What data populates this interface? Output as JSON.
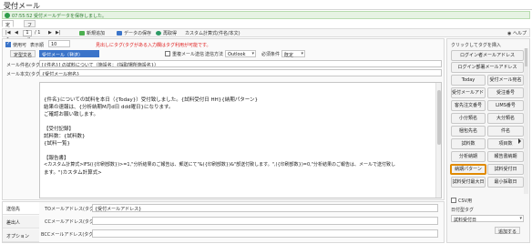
{
  "window": {
    "title": "受付メール"
  },
  "notice": {
    "text": "07:55:52 受付メールデータを保存しました。"
  },
  "tabs": {
    "active": "定型文",
    "other": "ファイル"
  },
  "toolbar": {
    "page_current": "1",
    "page_total": "/ 1",
    "new_label": "新規追加",
    "save_label": "データの保存",
    "reload_label": "再取得",
    "custom_label": "カスタム計算式(件名/本文)",
    "help_label": "ヘルプ"
  },
  "form": {
    "use_label": "使用可",
    "order_label": "表示順",
    "order_value": "10",
    "warning": "見出しにタグ(タグがある入力欄はタグ利用が可能です。",
    "template_label": "定型文名",
    "template_value": "受付メール（発送）",
    "duplicate_label": "重複メール送信",
    "send_method_label": "送信方法",
    "send_method_value": "Outlook",
    "required_label": "必須条件",
    "required_value": "既定",
    "subject_label": "メール件名(タグ)",
    "subject_value": "[{件名}] の試料について（施設名：{採取場所施設名}）",
    "body_label": "メール本文(タグ)"
  },
  "body": {
    "lines": [
      "{受付メール宛名}",
      "",
      "{件名}についての試料を本日（{Today}）受付致しました。{試料受付日 HH}{納期パターン}",
      "結果の速報は、{分析納期M月d日 ddd曜日}になります。",
      "ご確認お願い致します。",
      "",
      "【受付記録】",
      "試料数：{試料数}",
      "{試料一覧}",
      "",
      "【報告書】",
      "<カスタム計算式>IFS(({印刷部数})>=1,\"分析結果のご報告は、郵送にて\"&({印刷部数})&\"部送付致します。\",({印刷部数})=0,\"分析結果のご報告は、メールで送付致し",
      "ます。\")カスタム計算式>"
    ]
  },
  "bottom": {
    "tabs": [
      "送信先",
      "差出人",
      "オプション"
    ],
    "to_label": "TOメールアドレス(タグ)",
    "to_value": "{受付メールアドレス}",
    "cc_label": "CCメールアドレス(タグ)",
    "cc_value": "",
    "bcc_label": "BCCメールアドレス(タグ)",
    "bcc_value": ""
  },
  "side": {
    "title": "クリックしてタグを挿入",
    "tags": [
      "ログイン者メールアドレス",
      "ログイン部署メールアドレス",
      "Today",
      "受付メール宛名",
      "受付メールアドレス",
      "受注番号",
      "客先注文番号",
      "LIMS番号",
      "小分類名",
      "大分類名",
      "梱包先名",
      "件名",
      "試料数",
      "項目数",
      "分析納期",
      "報告書納期",
      "納期パターン",
      "試料受付日",
      "試料受付最大日",
      "最小採取日"
    ],
    "reset_label": "CSV用",
    "date_tag_label": "◻ CSV用",
    "date_label": "日付型タグ",
    "date_select": "試料受付日",
    "add_label": "追加する"
  }
}
